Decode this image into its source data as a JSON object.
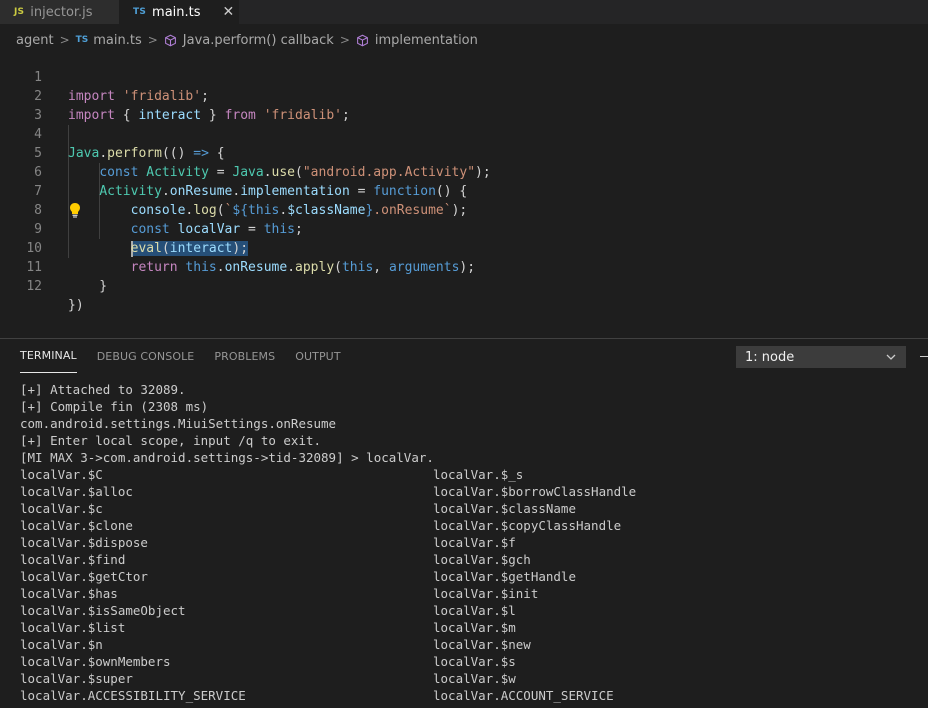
{
  "tabs": [
    {
      "lang": "JS",
      "label": "injector.js",
      "active": false
    },
    {
      "lang": "TS",
      "label": "main.ts",
      "active": true
    }
  ],
  "tab_close": "✕",
  "breadcrumb": {
    "folder": "agent",
    "file_lang": "TS",
    "file": "main.ts",
    "symbol1": "Java.perform() callback",
    "symbol2": "implementation"
  },
  "editor": {
    "line_numbers": [
      "1",
      "2",
      "3",
      "4",
      "5",
      "6",
      "7",
      "8",
      "9",
      "10",
      "11",
      "12"
    ]
  },
  "panel": {
    "tabs": [
      "TERMINAL",
      "DEBUG CONSOLE",
      "PROBLEMS",
      "OUTPUT"
    ],
    "active_tab": "TERMINAL",
    "terminal_select": "1: node"
  },
  "terminal": {
    "header_lines": [
      "[+] Attached to 32089.",
      "[+] Compile fin (2308 ms)",
      "com.android.settings.MiuiSettings.onResume",
      "[+] Enter local scope, input /q to exit.",
      "[MI MAX 3->com.android.settings->tid-32089] > localVar."
    ],
    "left_col": [
      "localVar.$C",
      "localVar.$alloc",
      "localVar.$c",
      "localVar.$clone",
      "localVar.$dispose",
      "localVar.$find",
      "localVar.$getCtor",
      "localVar.$has",
      "localVar.$isSameObject",
      "localVar.$list",
      "localVar.$n",
      "localVar.$ownMembers",
      "localVar.$super",
      "localVar.ACCESSIBILITY_SERVICE"
    ],
    "right_col": [
      "localVar.$_s",
      "localVar.$borrowClassHandle",
      "localVar.$className",
      "localVar.$copyClassHandle",
      "localVar.$f",
      "localVar.$gch",
      "localVar.$getHandle",
      "localVar.$init",
      "localVar.$l",
      "localVar.$m",
      "localVar.$new",
      "localVar.$s",
      "localVar.$w",
      "localVar.ACCOUNT_SERVICE"
    ]
  }
}
